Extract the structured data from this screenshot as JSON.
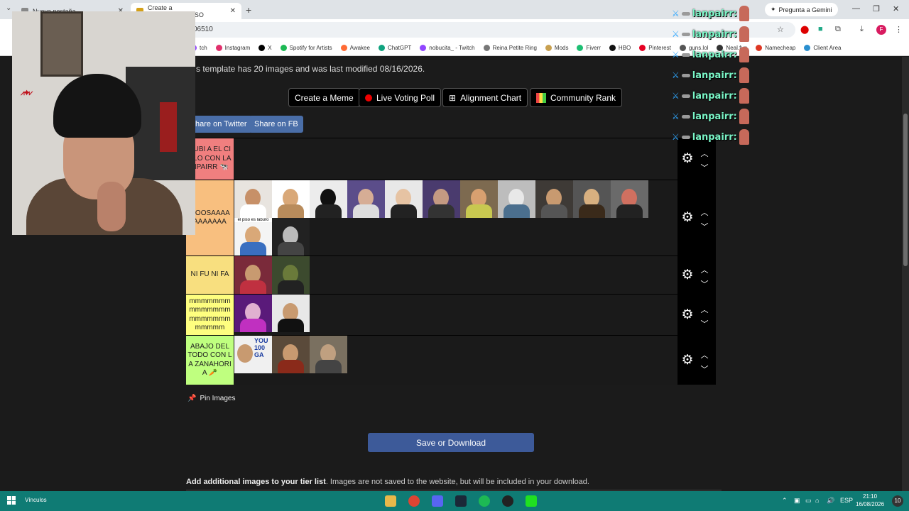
{
  "browser": {
    "tabs": [
      {
        "label": "Nueva pestaña",
        "active": false
      },
      {
        "label": "Create a GINSHHERVERSO",
        "active": true
      }
    ],
    "url": "06510",
    "gemini_label": "Pregunta a Gemini",
    "profile_initial": "F",
    "bookmarks": [
      {
        "label": "tch",
        "color": "#9146ff"
      },
      {
        "label": "Instagram",
        "color": "#e1306c"
      },
      {
        "label": "X",
        "color": "#000000"
      },
      {
        "label": "Spotify for Artists",
        "color": "#1db954"
      },
      {
        "label": "Awakee",
        "color": "#ff6b35"
      },
      {
        "label": "ChatGPT",
        "color": "#10a37f"
      },
      {
        "label": "nobucita_ - Twitch",
        "color": "#9146ff"
      },
      {
        "label": "Reina Petite Ring",
        "color": "#777777"
      },
      {
        "label": "Mods",
        "color": "#c8a050"
      },
      {
        "label": "Fiverr",
        "color": "#1dbf73"
      },
      {
        "label": "HBO",
        "color": "#111111"
      },
      {
        "label": "Pinterest",
        "color": "#e60023"
      },
      {
        "label": "guns.lol",
        "color": "#555555"
      },
      {
        "label": "Neal.fun",
        "color": "#333333"
      },
      {
        "label": "Namecheap",
        "color": "#de3723"
      },
      {
        "label": "Client Area",
        "color": "#2a8fcf"
      }
    ]
  },
  "page": {
    "info_text": "s template has 20 images and was last modified 08/16/2026.",
    "tools": {
      "create_meme": "Create a Meme",
      "live_poll": "Live Voting Poll",
      "alignment": "Alignment Chart",
      "community": "Community Rank"
    },
    "share": {
      "twitter": "hare on Twitter",
      "fb": "Share on FB"
    },
    "tiers": [
      {
        "label": "SUBI A EL CIELO CON LANPAIRR 🐄",
        "color": "#f07f7f",
        "count": 0
      },
      {
        "label": "GOOSAAAAAAAAAAA",
        "color": "#f8bf7f",
        "count": 12
      },
      {
        "label": "NI FU NI FA",
        "color": "#f8df7f",
        "count": 2
      },
      {
        "label": "mmmmmmmmmmmmmmmmmmmmmmmmmm",
        "color": "#fefe7f",
        "count": 2
      },
      {
        "label": "ABAJO DEL TODO CON LA ZANAHORIA 🥕",
        "color": "#bfff7f",
        "count": 3
      }
    ],
    "pin_label": "Pin Images",
    "save_label": "Save or Download",
    "add_text_bold": "Add additional images to your tier list",
    "add_text_rest": ". Images are not saved to the website, but will be included in your download.",
    "thumb_caption": "el piso es laburo",
    "thumb_caption_2": "YOU 100 GA"
  },
  "chat": {
    "username": "lanpairr:",
    "lines": 7
  },
  "taskbar": {
    "label": "Vínculos",
    "lang": "ESP",
    "time": "21:10",
    "date": "16/08/2026",
    "notifications": "10"
  }
}
